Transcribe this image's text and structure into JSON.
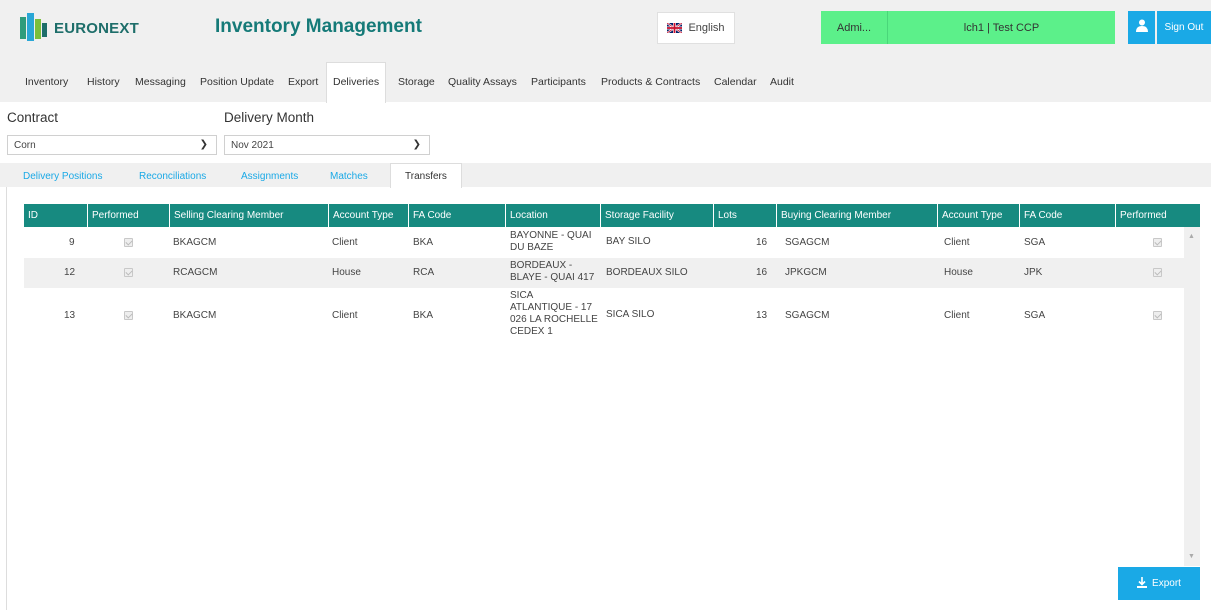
{
  "brand": {
    "name": "EURONEXT",
    "color": "#1e6e6a"
  },
  "app": {
    "title": "Inventory Management",
    "accent": "#157a78"
  },
  "header": {
    "language": "English",
    "language_icon": "uk-flag-icon",
    "user_short": "Admi...",
    "account": "lch1 | Test CCP",
    "user_icon": "user-icon",
    "sign_out": "Sign Out",
    "highlight_color": "#5cf08a",
    "button_color": "#1aa9e6"
  },
  "nav": {
    "items": [
      "Inventory",
      "History",
      "Messaging",
      "Position Update",
      "Export",
      "Deliveries",
      "Storage",
      "Quality Assays",
      "Participants",
      "Products & Contracts",
      "Calendar",
      "Audit"
    ],
    "active": "Deliveries"
  },
  "filters": {
    "contract_label": "Contract",
    "contract_value": "Corn",
    "month_label": "Delivery Month",
    "month_value": "Nov 2021"
  },
  "subtabs": {
    "items": [
      "Delivery Positions",
      "Reconciliations",
      "Assignments",
      "Matches",
      "Transfers"
    ],
    "active": "Transfers"
  },
  "table": {
    "header_color": "#178a80",
    "columns": [
      "ID",
      "Performed",
      "Selling Clearing Member",
      "Account Type",
      "FA Code",
      "Location",
      "Storage Facility",
      "Lots",
      "Buying Clearing Member",
      "Account Type",
      "FA Code",
      "Performed"
    ],
    "rows": [
      {
        "id": "9",
        "performed": true,
        "selling": "BKAGCM",
        "account_type": "Client",
        "fa_code": "BKA",
        "location": [
          "BAYONNE - QUAI",
          "DU BAZE"
        ],
        "storage": "BAY SILO",
        "lots": "16",
        "buying": "SGAGCM",
        "buy_account_type": "Client",
        "buy_fa_code": "SGA",
        "buy_performed": true
      },
      {
        "id": "12",
        "performed": true,
        "selling": "RCAGCM",
        "account_type": "House",
        "fa_code": "RCA",
        "location": [
          "BORDEAUX -",
          "BLAYE - QUAI 417"
        ],
        "storage": "BORDEAUX SILO",
        "lots": "16",
        "buying": "JPKGCM",
        "buy_account_type": "House",
        "buy_fa_code": "JPK",
        "buy_performed": true
      },
      {
        "id": "13",
        "performed": true,
        "selling": "BKAGCM",
        "account_type": "Client",
        "fa_code": "BKA",
        "location": [
          "SICA",
          "ATLANTIQUE - 17",
          "026 LA ROCHELLE",
          "CEDEX 1"
        ],
        "storage": "SICA SILO",
        "lots": "13",
        "buying": "SGAGCM",
        "buy_account_type": "Client",
        "buy_fa_code": "SGA",
        "buy_performed": true
      }
    ]
  },
  "export": {
    "label": "Export",
    "icon": "download-icon"
  }
}
